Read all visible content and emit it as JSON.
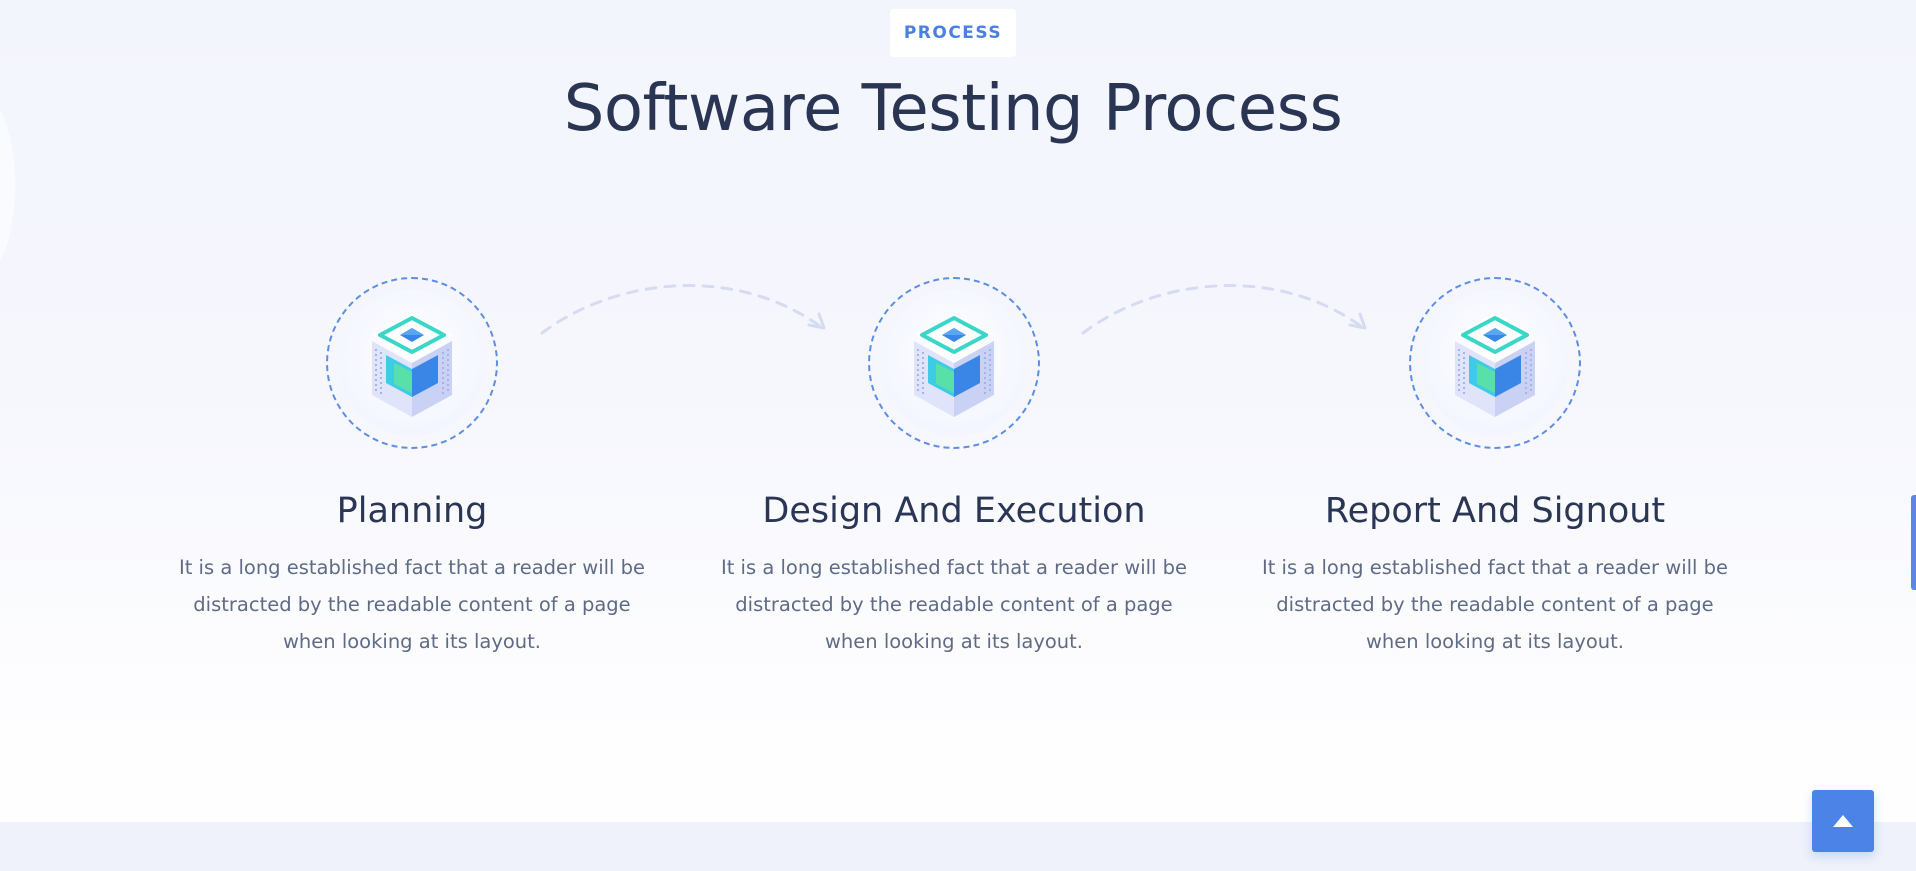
{
  "section": {
    "badge": "PROCESS",
    "title": "Software Testing Process"
  },
  "steps": [
    {
      "icon": "server-cube-icon",
      "title": "Planning",
      "text": "It is a long established fact that a reader will be distracted by the readable content of a page when looking at its layout."
    },
    {
      "icon": "server-cube-icon",
      "title": "Design And Execution",
      "text": "It is a long established fact that a reader will be distracted by the readable content of a page when looking at its layout."
    },
    {
      "icon": "server-cube-icon",
      "title": "Report And Signout",
      "text": "It is a long established fact that a reader will be distracted by the readable content of a page when looking at its layout."
    }
  ],
  "scroll_top": {
    "icon": "arrow-up-icon"
  },
  "colors": {
    "accent": "#4b84e6",
    "heading": "#2a3553",
    "body_text": "#5f6b86",
    "ring": "#5d8ee2"
  }
}
